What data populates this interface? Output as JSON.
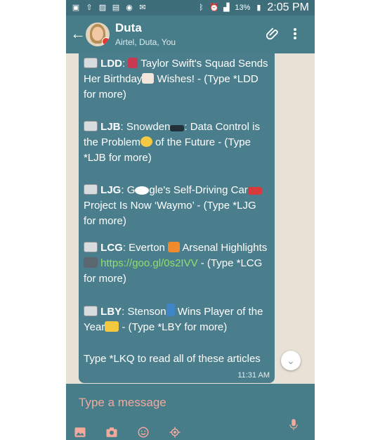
{
  "status_bar": {
    "battery": "13%",
    "time": "2:05 PM"
  },
  "header": {
    "title": "Duta",
    "subtitle": "Airtel, Duta, You"
  },
  "messages": [
    {
      "code": "LDD",
      "text_a": ": ",
      "text_b": "Taylor Swift's Squad Sends Her Birthday",
      "text_c": " Wishes! - (Type *LDD for more)"
    },
    {
      "code": "LJB",
      "text_a": ": Snowden",
      "text_b": ": Data Control is the Problem",
      "text_c": " of the Future - (Type *LJB for more)"
    },
    {
      "code": "LJG",
      "text_a": ": G",
      "text_b": "gle's Self-Driving Car",
      "text_c": " Project Is Now ‘Waymo’ - (Type *LJG for more)"
    },
    {
      "code": "LCG",
      "text_a": ": Everton ",
      "text_b": " Arsenal Highlights ",
      "link": "https://goo.gl/0s2IVV",
      "text_c": " - (Type *LCG for more)"
    },
    {
      "code": "LBY",
      "text_a": ": Stenson",
      "text_b": " Wins Player of the Year",
      "text_c": " - (Type *LBY for more)"
    }
  ],
  "footer_line": "Type *LKQ to read all of these articles",
  "timestamp": "11:31 AM",
  "composer": {
    "placeholder": "Type a message"
  },
  "colors": {
    "status_bar": "#3f6e7b",
    "app_bar": "#467d89",
    "bubble": "#4a7e8c",
    "link": "#8ee06b",
    "placeholder": "#f3a99c"
  }
}
